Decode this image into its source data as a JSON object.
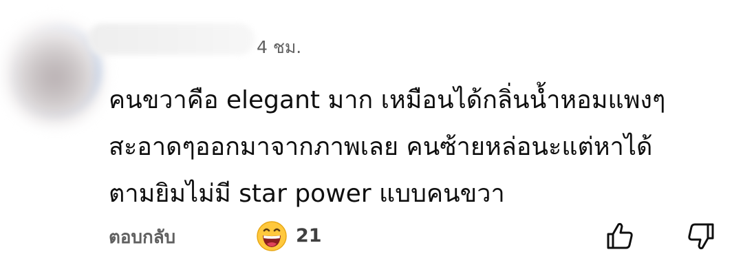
{
  "comment": {
    "timestamp": "4 ชม.",
    "text_lines": [
      "คนขวาคือ elegant มาก เหมือนได้กลิ่นน้ำหอมแพงๆ",
      "สะอาดๆออกมาจากภาพเลย คนซ้ายหล่อนะแต่หาได้",
      "ตามยิมไม่มี star power แบบคนขวา"
    ]
  },
  "actions": {
    "reply_label": "ตอบกลับ",
    "reaction_icon": "grinning-face-emoji-icon",
    "reaction_count": "21",
    "like_icon": "thumbs-up-icon",
    "dislike_icon": "thumbs-down-icon"
  },
  "colors": {
    "text_primary": "#0f0f0f",
    "text_secondary": "#606060",
    "avatar_accent": "#2b7de9",
    "emoji_face": "#ffc83d",
    "emoji_mouth": "#8a1f1f"
  }
}
